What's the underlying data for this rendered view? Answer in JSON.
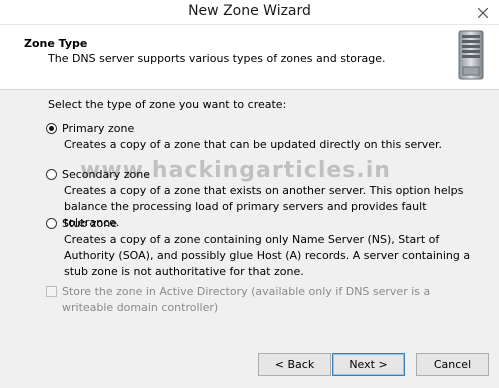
{
  "window": {
    "title": "New Zone Wizard"
  },
  "header": {
    "title": "Zone Type",
    "description": "The DNS server supports various types of zones and storage."
  },
  "content": {
    "prompt": "Select the type of zone you want to create:",
    "options": [
      {
        "label": "Primary zone",
        "selected": true,
        "description": "Creates a copy of a zone that can be updated directly on this server."
      },
      {
        "label": "Secondary zone",
        "selected": false,
        "description": "Creates a copy of a zone that exists on another server. This option helps balance the processing load of primary servers and provides fault tolerance."
      },
      {
        "label": "Stub zone",
        "selected": false,
        "description": "Creates a copy of a zone containing only Name Server (NS), Start of Authority (SOA), and possibly glue Host (A) records. A server containing a stub zone is not authoritative for that zone."
      }
    ],
    "ad_checkbox": {
      "label": "Store the zone in Active Directory (available only if DNS server is a writeable domain controller)",
      "checked": false,
      "enabled": false
    },
    "watermark": "www.hackingarticles.in"
  },
  "buttons": {
    "back": "< Back",
    "next": "Next >",
    "cancel": "Cancel"
  },
  "icons": {
    "close": "close-icon",
    "server": "server-icon"
  },
  "colors": {
    "content_bg": "#f0f0f0",
    "default_button_border": "#3c7fb1"
  }
}
